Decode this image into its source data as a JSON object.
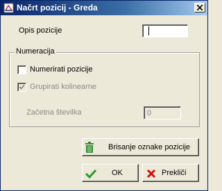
{
  "window": {
    "title": "Načrt pozicij - Greda"
  },
  "opis": {
    "label": "Opis pozicije",
    "value": ""
  },
  "numeracija": {
    "legend": "Numeracija",
    "numerirati": {
      "label": "Numerirati pozicije",
      "checked": false
    },
    "grupirati": {
      "label": "Grupirati kolinearne",
      "checked": true,
      "enabled": false
    }
  },
  "zacetna": {
    "label": "Začetna številka",
    "value": "0"
  },
  "buttons": {
    "brisanje": "Brisanje oznake pozicije",
    "ok": "OK",
    "preklici": "Prekliči"
  },
  "colors": {
    "ok_check": "#2e9a2e",
    "cancel_x": "#d01010",
    "trash": "#3a8a3a"
  }
}
